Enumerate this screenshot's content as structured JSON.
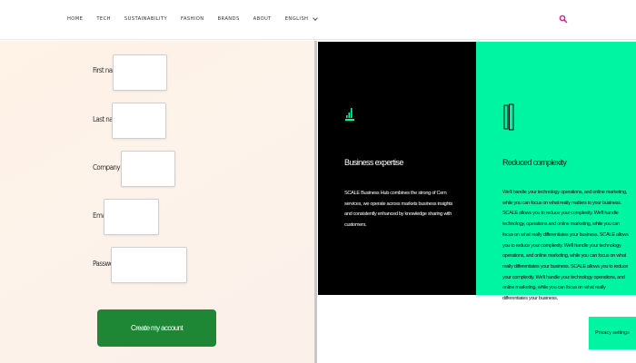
{
  "nav": {
    "items": [
      "HOME",
      "TECH",
      "SUSTAINABILITY",
      "FASHION",
      "BRANDS",
      "ABOUT"
    ],
    "language": "ENGLISH",
    "search_icon": "search-icon",
    "accent_color": "#e0198b"
  },
  "form": {
    "first_name_label": "First name",
    "last_name_label": "Last name",
    "company_name_label": "Company name",
    "email_label": "Email",
    "password_label": "Password",
    "submit_label": "Create my account"
  },
  "features": [
    {
      "icon": "signal-bars-icon",
      "title": "Business expertise",
      "body": "SCALE Business Hub combines the strong of Cern services, we operate across markets business insights and consistently enhanced by knowledge sharing with customers."
    },
    {
      "icon": "phone-outline-icon",
      "title": "Reduced complexity",
      "body": "We'll handle your technology operations, and online marketing, while you can focus on what really matters to your business. SCALE allows you to reduce your complexity. We'll handle technology, operations and online marketing, while you can focus on what really differentiates your business. SCALE allows you to reduce your complexity. We'll handle your technology operations, and online marketing, while you can focus on what really differentiates your business. SCALE allows you to reduce your complexity. We'll handle your technology operations, and online marketing, while you can focus on what really differentiates your business."
    }
  ],
  "cookie": {
    "label": "Privacy settings"
  }
}
